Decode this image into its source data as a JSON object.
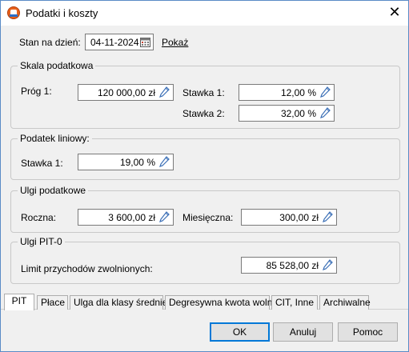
{
  "window": {
    "title": "Podatki i koszty",
    "close_icon": "close-icon",
    "app_icon": "cit-app-icon"
  },
  "date_row": {
    "label": "Stan na dzień:",
    "date_value": "04-11-2024",
    "show_link": "Pokaż"
  },
  "tax_scale": {
    "title": "Skala podatkowa",
    "threshold_label": "Próg 1:",
    "threshold_value": "120 000,00 zł",
    "rate1_label": "Stawka 1:",
    "rate1_value": "12,00 %",
    "rate2_label": "Stawka 2:",
    "rate2_value": "32,00 %"
  },
  "flat_tax": {
    "title": "Podatek liniowy:",
    "rate_label": "Stawka 1:",
    "rate_value": "19,00 %"
  },
  "tax_relief": {
    "title": "Ulgi podatkowe",
    "annual_label": "Roczna:",
    "annual_value": "3 600,00 zł",
    "monthly_label": "Miesięczna:",
    "monthly_value": "300,00 zł"
  },
  "pit0": {
    "title": "Ulgi PIT-0",
    "limit_label": "Limit przychodów zwolnionych:",
    "limit_value": "85 528,00 zł"
  },
  "tabs": [
    {
      "label": "PIT",
      "active": true
    },
    {
      "label": "Płace",
      "active": false
    },
    {
      "label": "Ulga dla klasy średniej",
      "active": false
    },
    {
      "label": "Degresywna kwota wolna",
      "active": false
    },
    {
      "label": "CIT, Inne",
      "active": false
    },
    {
      "label": "Archiwalne",
      "active": false
    }
  ],
  "buttons": {
    "ok": "OK",
    "cancel": "Anuluj",
    "help": "Pomoc"
  },
  "colors": {
    "accent": "#0078d7",
    "window_border": "#5a8bc6",
    "dialog_bg": "#f0f0f0",
    "pencil_blue": "#3b6fb6"
  }
}
